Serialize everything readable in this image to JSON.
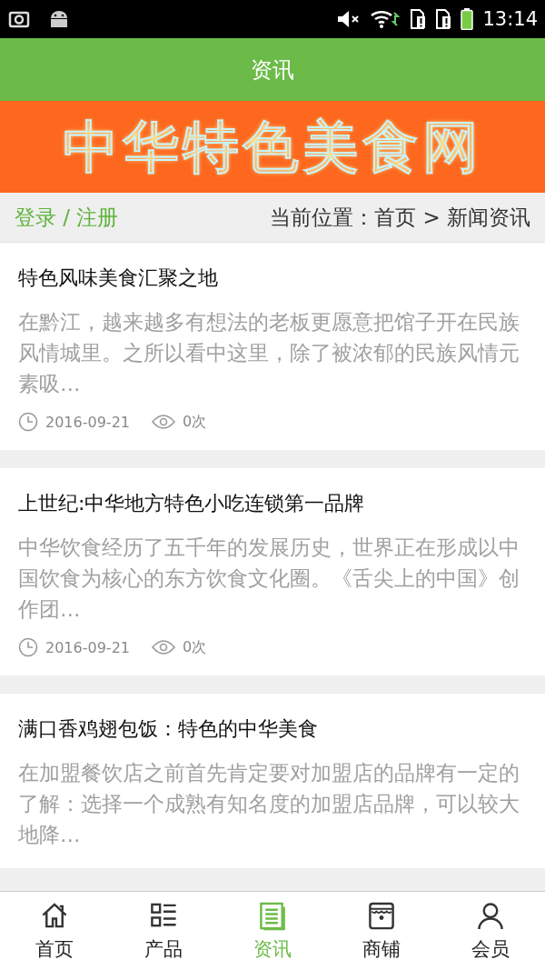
{
  "status_bar": {
    "time": "13:14"
  },
  "header": {
    "title": "资讯"
  },
  "banner": {
    "logo": "中华特色美食网"
  },
  "breadcrumb_bar": {
    "login": "登录 / 注册",
    "location": "当前位置：首页 > 新闻资讯"
  },
  "articles": [
    {
      "title": "特色风味美食汇聚之地",
      "summary": "在黔江，越来越多有想法的老板更愿意把馆子开在民族风情城里。之所以看中这里，除了被浓郁的民族风情元素吸…",
      "date": "2016-09-21",
      "views": "0次"
    },
    {
      "title": "上世纪:中华地方特色小吃连锁第一品牌",
      "summary": "中华饮食经历了五千年的发展历史，世界正在形成以中国饮食为核心的东方饮食文化圈。《舌尖上的中国》创作团…",
      "date": "2016-09-21",
      "views": "0次"
    },
    {
      "title": "满口香鸡翅包饭：特色的中华美食",
      "summary": "在加盟餐饮店之前首先肯定要对加盟店的品牌有一定的了解：选择一个成熟有知名度的加盟店品牌，可以较大地降…"
    }
  ],
  "bottom_nav": [
    {
      "label": "首页",
      "kind": "home",
      "selected": false
    },
    {
      "label": "产品",
      "kind": "list",
      "selected": false
    },
    {
      "label": "资讯",
      "kind": "news",
      "selected": true
    },
    {
      "label": "商铺",
      "kind": "shop",
      "selected": false
    },
    {
      "label": "会员",
      "kind": "user",
      "selected": false
    }
  ]
}
